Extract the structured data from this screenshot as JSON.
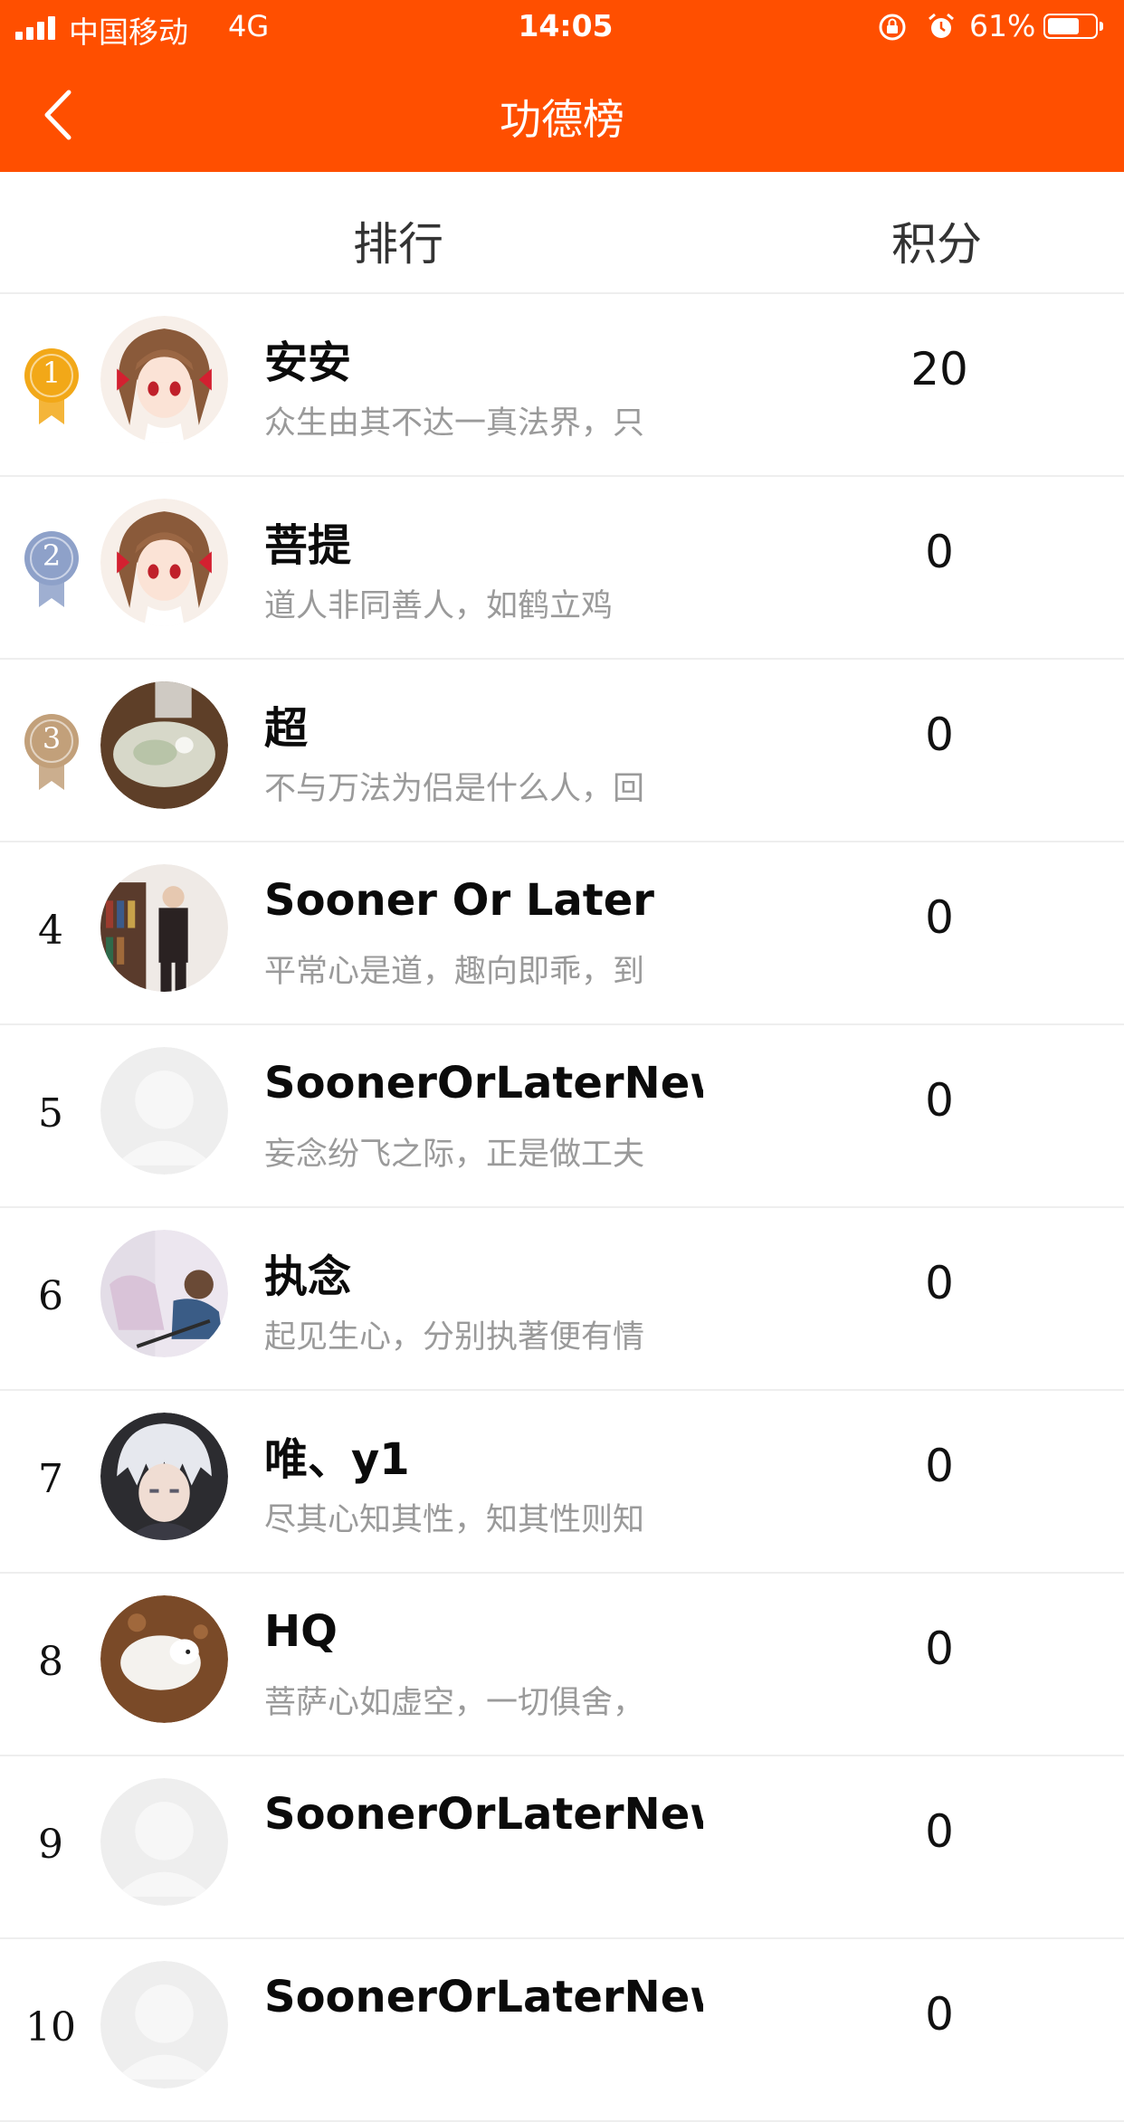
{
  "status_bar": {
    "carrier": "中国移动",
    "network": "4G",
    "time": "14:05",
    "battery_percent": "61%"
  },
  "nav": {
    "title": "功德榜"
  },
  "list_header": {
    "rank_label": "排行",
    "score_label": "积分"
  },
  "colors": {
    "header_bg": "#ff4f00",
    "gold": "#f2a818",
    "silver": "#8ea1c9",
    "bronze": "#c2a07a"
  },
  "rows": [
    {
      "rank": "1",
      "medal": "gold",
      "name": "安安",
      "bio": "众生由其不达一真法界，只",
      "score": "20",
      "avatar": "anime-girl-avatar"
    },
    {
      "rank": "2",
      "medal": "silver",
      "name": "菩提",
      "bio": "道人非同善人，如鹤立鸡",
      "score": "0",
      "avatar": "anime-girl-avatar"
    },
    {
      "rank": "3",
      "medal": "bronze",
      "name": "超",
      "bio": "不与万法为侣是什么人，回",
      "score": "0",
      "avatar": "dog-photo-avatar"
    },
    {
      "rank": "4",
      "medal": "",
      "name": "Sooner Or Later",
      "bio": "平常心是道，趣向即乖，到",
      "score": "0",
      "avatar": "person-photo-avatar"
    },
    {
      "rank": "5",
      "medal": "",
      "name": "SoonerOrLaterNewBie",
      "bio": "妄念纷飞之际，正是做工夫",
      "score": "0",
      "avatar": "default-avatar"
    },
    {
      "rank": "6",
      "medal": "",
      "name": "执念",
      "bio": "起见生心，分别执著便有情",
      "score": "0",
      "avatar": "child-photo-avatar"
    },
    {
      "rank": "7",
      "medal": "",
      "name": "唯、y1",
      "bio": "尽其心知其性，知其性则知",
      "score": "0",
      "avatar": "anime-boy-avatar"
    },
    {
      "rank": "8",
      "medal": "",
      "name": "HQ",
      "bio": "菩萨心如虚空，一切俱舍，",
      "score": "0",
      "avatar": "white-dog-avatar"
    },
    {
      "rank": "9",
      "medal": "",
      "name": "SoonerOrLaterNewBie",
      "bio": "",
      "score": "0",
      "avatar": "default-avatar"
    },
    {
      "rank": "10",
      "medal": "",
      "name": "SoonerOrLaterNewBie",
      "bio": "",
      "score": "0",
      "avatar": "default-avatar"
    }
  ]
}
